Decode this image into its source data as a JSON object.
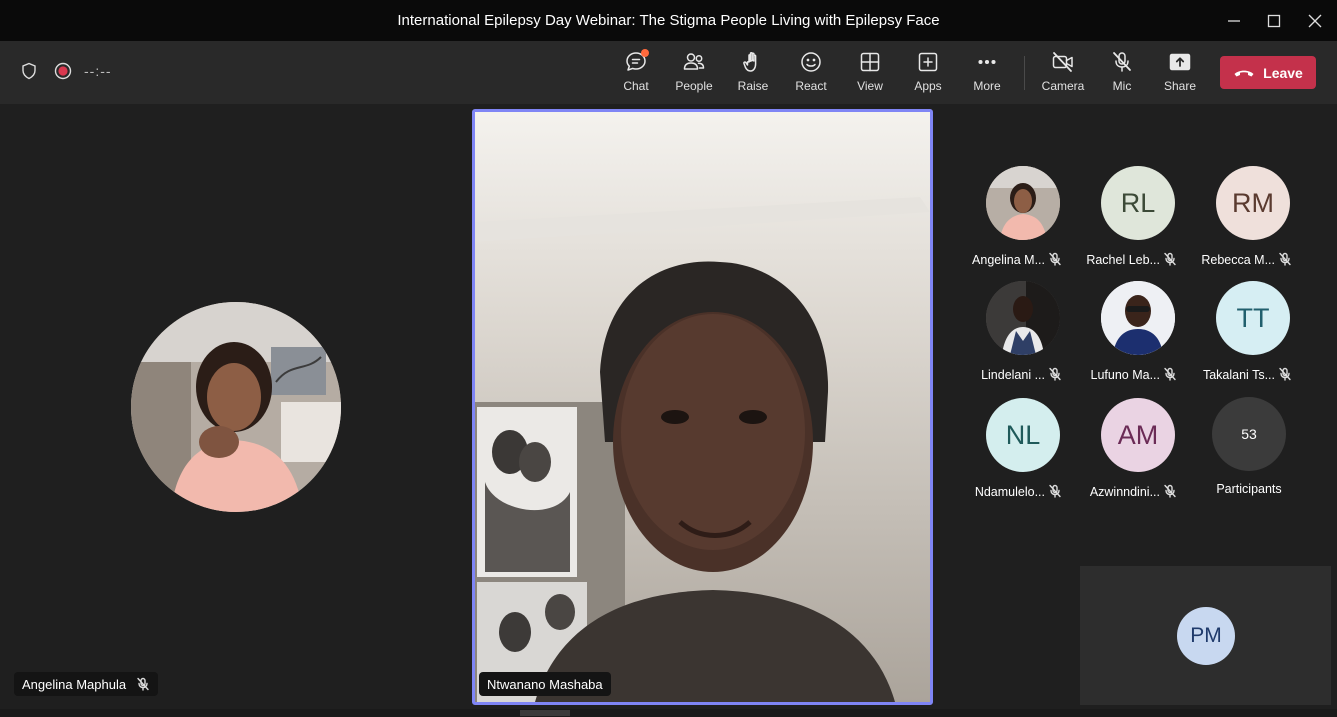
{
  "window": {
    "title": "International Epilepsy Day Webinar: The Stigma People Living with Epilepsy Face"
  },
  "toolbar": {
    "timer": "--:--",
    "chat": "Chat",
    "people": "People",
    "raise": "Raise",
    "react": "React",
    "view": "View",
    "apps": "Apps",
    "more": "More",
    "camera": "Camera",
    "mic": "Mic",
    "share": "Share",
    "leave": "Leave"
  },
  "stage": {
    "left_name": "Angelina Maphula",
    "main_name": "Ntwanano Mashaba"
  },
  "participants": [
    {
      "initials": "",
      "name": "Angelina M...",
      "bg": "#b9a595",
      "photo": true
    },
    {
      "initials": "RL",
      "name": "Rachel Leb...",
      "bg": "#dfe6da",
      "fg": "#3c4a37"
    },
    {
      "initials": "RM",
      "name": "Rebecca M...",
      "bg": "#efe0db",
      "fg": "#5a3a2f"
    },
    {
      "initials": "",
      "name": "Lindelani ...",
      "bg": "#5c5a58",
      "photo": true
    },
    {
      "initials": "",
      "name": "Lufuno Ma...",
      "bg": "#e9ecf2",
      "photo": true
    },
    {
      "initials": "TT",
      "name": "Takalani Ts...",
      "bg": "#d6eef3",
      "fg": "#215f6d"
    },
    {
      "initials": "NL",
      "name": "Ndamulelo...",
      "bg": "#d4eeee",
      "fg": "#1f5a5a"
    },
    {
      "initials": "AM",
      "name": "Azwinndini...",
      "bg": "#ead3e3",
      "fg": "#6b2b56"
    }
  ],
  "overflow": {
    "count": "53",
    "label": "Participants"
  },
  "selfview": {
    "initials": "PM"
  }
}
